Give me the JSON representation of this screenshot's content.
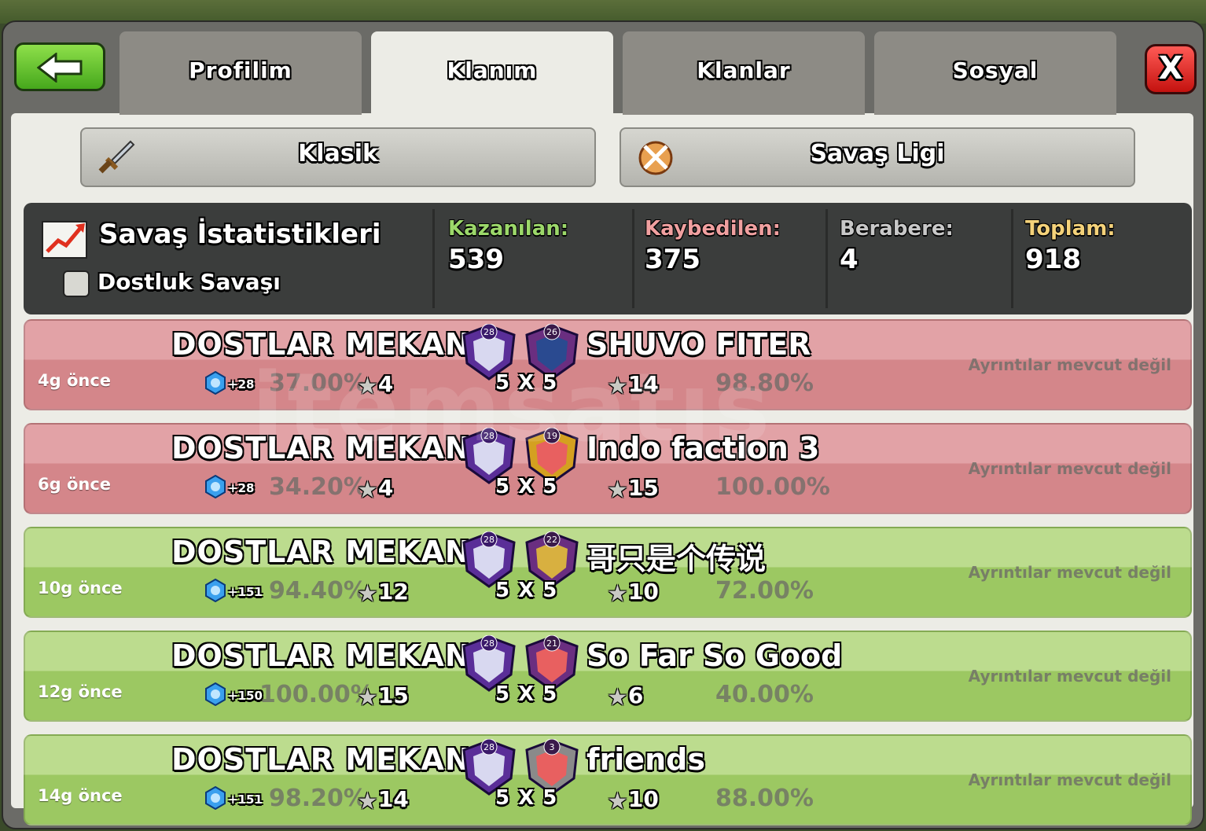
{
  "tabs": [
    "Profilim",
    "Klanım",
    "Klanlar",
    "Sosyal"
  ],
  "active_tab": "Klanım",
  "close_label": "X",
  "sub_tabs": {
    "classic": "Klasik",
    "league": "Savaş Ligi"
  },
  "stats": {
    "title": "Savaş İstatistikleri",
    "friendly_label": "Dostluk Savaşı",
    "won_label": "Kazanılan:",
    "won": "539",
    "lost_label": "Kaybedilen:",
    "lost": "375",
    "draw_label": "Berabere:",
    "draw": "4",
    "total_label": "Toplam:",
    "total": "918",
    "colors": {
      "won": "#9cd86a",
      "lost": "#f0a0a0",
      "draw": "#c8c8c8",
      "total": "#f4d27a"
    }
  },
  "wars": [
    {
      "ago": "4g önce",
      "result": "lost",
      "clan": "DOSTLAR MEKANI",
      "clan_level": "28",
      "xp": "+28",
      "clan_pct": "37.00%",
      "clan_stars": "4",
      "size": "5 X 5",
      "opp": "SHUVO FITER",
      "opp_level": "26",
      "opp_stars": "14",
      "opp_pct": "98.80%",
      "details": "Ayrıntılar mevcut değil"
    },
    {
      "ago": "6g önce",
      "result": "lost",
      "clan": "DOSTLAR MEKANI",
      "clan_level": "28",
      "xp": "+28",
      "clan_pct": "34.20%",
      "clan_stars": "4",
      "size": "5 X 5",
      "opp": "Indo faction 3",
      "opp_level": "19",
      "opp_stars": "15",
      "opp_pct": "100.00%",
      "details": "Ayrıntılar mevcut değil"
    },
    {
      "ago": "10g önce",
      "result": "won",
      "clan": "DOSTLAR MEKANI",
      "clan_level": "28",
      "xp": "+151",
      "clan_pct": "94.40%",
      "clan_stars": "12",
      "size": "5 X 5",
      "opp": "哥只是个传说",
      "opp_level": "22",
      "opp_stars": "10",
      "opp_pct": "72.00%",
      "details": "Ayrıntılar mevcut değil"
    },
    {
      "ago": "12g önce",
      "result": "won",
      "clan": "DOSTLAR MEKANI",
      "clan_level": "28",
      "xp": "+150",
      "clan_pct": "100.00%",
      "clan_stars": "15",
      "size": "5 X 5",
      "opp": "So Far So Good",
      "opp_level": "21",
      "opp_stars": "6",
      "opp_pct": "40.00%",
      "details": "Ayrıntılar mevcut değil"
    },
    {
      "ago": "14g önce",
      "result": "won",
      "clan": "DOSTLAR MEKANI",
      "clan_level": "28",
      "xp": "+151",
      "clan_pct": "98.20%",
      "clan_stars": "14",
      "size": "5 X 5",
      "opp": "friends",
      "opp_level": "3",
      "opp_stars": "10",
      "opp_pct": "88.00%",
      "details": "Ayrıntılar mevcut değil"
    }
  ],
  "icons": [
    "back-arrow-icon",
    "close-icon",
    "sword-icon",
    "crossed-swords-icon",
    "chart-icon",
    "star-icon",
    "clan-badge-icon",
    "xp-gem-icon"
  ]
}
